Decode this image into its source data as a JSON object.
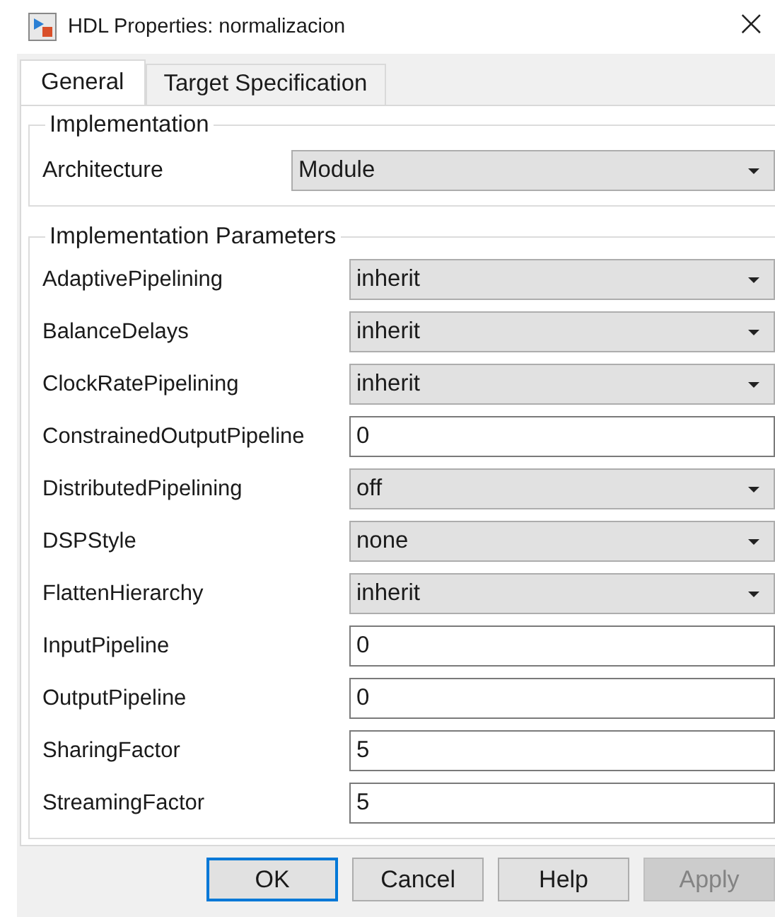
{
  "window": {
    "title": "HDL Properties: normalizacion",
    "close": "×"
  },
  "tabs": [
    {
      "label": "General",
      "selected": true
    },
    {
      "label": "Target Specification",
      "selected": false
    }
  ],
  "implementation": {
    "title": "Implementation",
    "label": "Architecture",
    "value": "Module"
  },
  "parameters": {
    "title": "Implementation Parameters",
    "rows": [
      {
        "label": "AdaptivePipelining",
        "kind": "dropdown",
        "value": "inherit"
      },
      {
        "label": "BalanceDelays",
        "kind": "dropdown",
        "value": "inherit"
      },
      {
        "label": "ClockRatePipelining",
        "kind": "dropdown",
        "value": "inherit"
      },
      {
        "label": "ConstrainedOutputPipeline",
        "kind": "text",
        "value": "0"
      },
      {
        "label": "DistributedPipelining",
        "kind": "dropdown",
        "value": "off"
      },
      {
        "label": "DSPStyle",
        "kind": "dropdown",
        "value": "none"
      },
      {
        "label": "FlattenHierarchy",
        "kind": "dropdown",
        "value": "inherit"
      },
      {
        "label": "InputPipeline",
        "kind": "text",
        "value": "0"
      },
      {
        "label": "OutputPipeline",
        "kind": "text",
        "value": "0"
      },
      {
        "label": "SharingFactor",
        "kind": "text",
        "value": "5"
      },
      {
        "label": "StreamingFactor",
        "kind": "text",
        "value": "5"
      }
    ]
  },
  "buttons": [
    {
      "label": "OK",
      "default": true,
      "disabled": false
    },
    {
      "label": "Cancel",
      "default": false,
      "disabled": false
    },
    {
      "label": "Help",
      "default": false,
      "disabled": false
    },
    {
      "label": "Apply",
      "default": false,
      "disabled": true
    }
  ]
}
